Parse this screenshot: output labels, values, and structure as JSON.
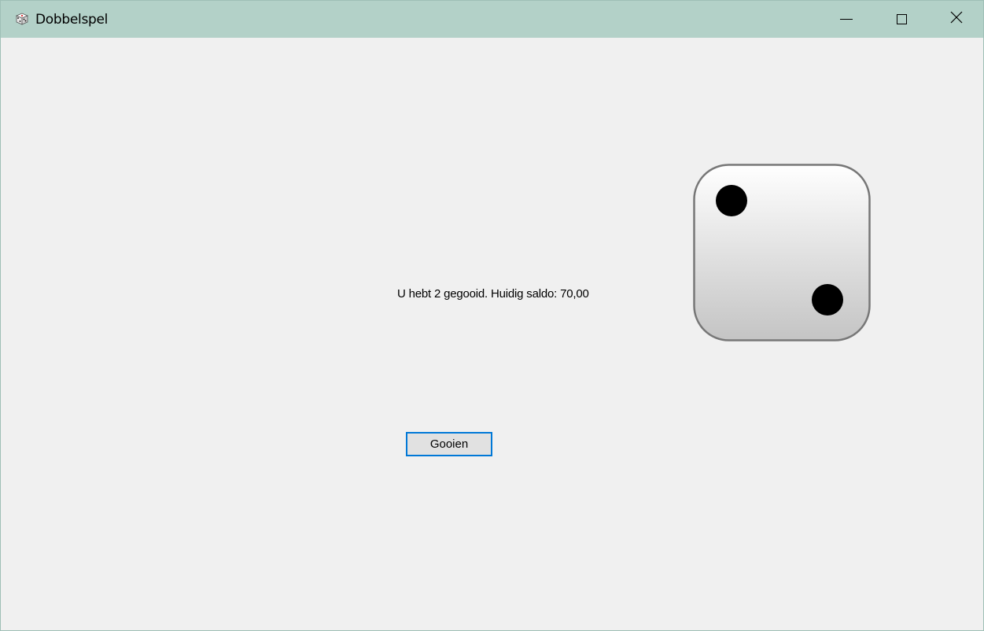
{
  "window": {
    "title": "Dobbelspel",
    "app_icon": "dice-icon",
    "controls": {
      "minimize": "minimize-icon",
      "maximize": "maximize-icon",
      "close": "close-icon"
    },
    "titlebar_color": "#b3d1c8"
  },
  "game": {
    "result_text": "U hebt 2 gegooid. Huidig saldo: 70,00",
    "die_value": 2,
    "roll_button_label": "Gooien",
    "accent_color": "#0078d7"
  }
}
